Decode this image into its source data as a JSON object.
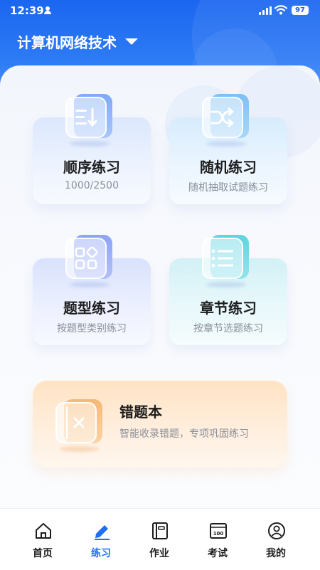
{
  "status_bar": {
    "time": "12:39",
    "battery": "97"
  },
  "header": {
    "subject": "计算机网络技术"
  },
  "cards": [
    {
      "title": "顺序练习",
      "subtitle": "1000/2500",
      "icon": "sequence-list-icon"
    },
    {
      "title": "随机练习",
      "subtitle": "随机抽取试题练习",
      "icon": "shuffle-icon"
    },
    {
      "title": "题型练习",
      "subtitle": "按题型类别练习",
      "icon": "grid-category-icon"
    },
    {
      "title": "章节练习",
      "subtitle": "按章节选题练习",
      "icon": "chapter-list-icon"
    }
  ],
  "wrong_book": {
    "title": "错题本",
    "subtitle": "智能收录错题，专项巩固练习",
    "icon": "wrong-book-icon"
  },
  "tabs": [
    {
      "label": "首页",
      "icon": "home-icon"
    },
    {
      "label": "练习",
      "icon": "pencil-icon",
      "active": true
    },
    {
      "label": "作业",
      "icon": "notebook-icon"
    },
    {
      "label": "考试",
      "icon": "exam-score-icon"
    },
    {
      "label": "我的",
      "icon": "profile-icon"
    }
  ],
  "colors": {
    "brand": "#1f6ff0",
    "header": "#1a66f0",
    "wrong_book": "#ffe3c4"
  }
}
